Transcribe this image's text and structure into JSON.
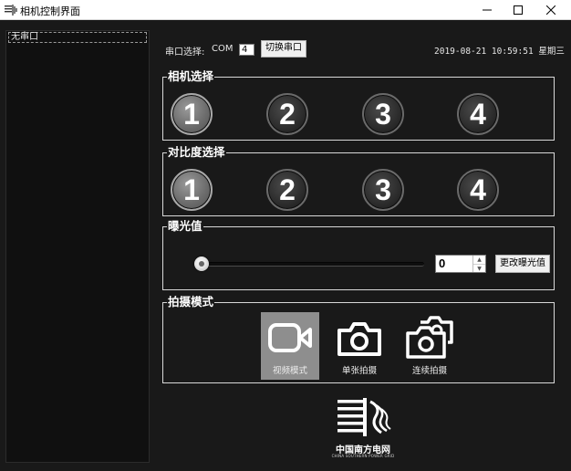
{
  "window": {
    "title": "相机控制界面",
    "controls": [
      "minimize-icon",
      "maximize-icon",
      "close-icon"
    ]
  },
  "sidebar": {
    "items": [
      {
        "label": "无串口"
      }
    ]
  },
  "serial": {
    "label": "串口选择:",
    "com_label": "COM",
    "com_value": "4",
    "switch_button": "切换串口"
  },
  "datetime": "2019-08-21 10:59:51 星期三",
  "camera_select": {
    "title": "相机选择",
    "options": [
      "1",
      "2",
      "3",
      "4"
    ],
    "selected": "1"
  },
  "contrast_select": {
    "title": "对比度选择",
    "options": [
      "1",
      "2",
      "3",
      "4"
    ],
    "selected": "1"
  },
  "exposure": {
    "title": "曝光值",
    "slider_value": 0,
    "spin_value": "0",
    "apply_button": "更改曝光值"
  },
  "capture_mode": {
    "title": "拍摄模式",
    "modes": [
      {
        "label": "视频模式",
        "icon": "video-camera-icon",
        "active": true
      },
      {
        "label": "单张拍摄",
        "icon": "camera-icon",
        "active": false
      },
      {
        "label": "连续拍摄",
        "icon": "multi-camera-icon",
        "active": false
      }
    ]
  },
  "logo": {
    "name_cn": "中国南方电网",
    "name_en": "CHINA SOUTHERN POWER GRID"
  },
  "colors": {
    "background": "#191919",
    "sidebar": "#101010",
    "group_border": "#d8d8d8",
    "active_mode": "#8e8e8e"
  }
}
